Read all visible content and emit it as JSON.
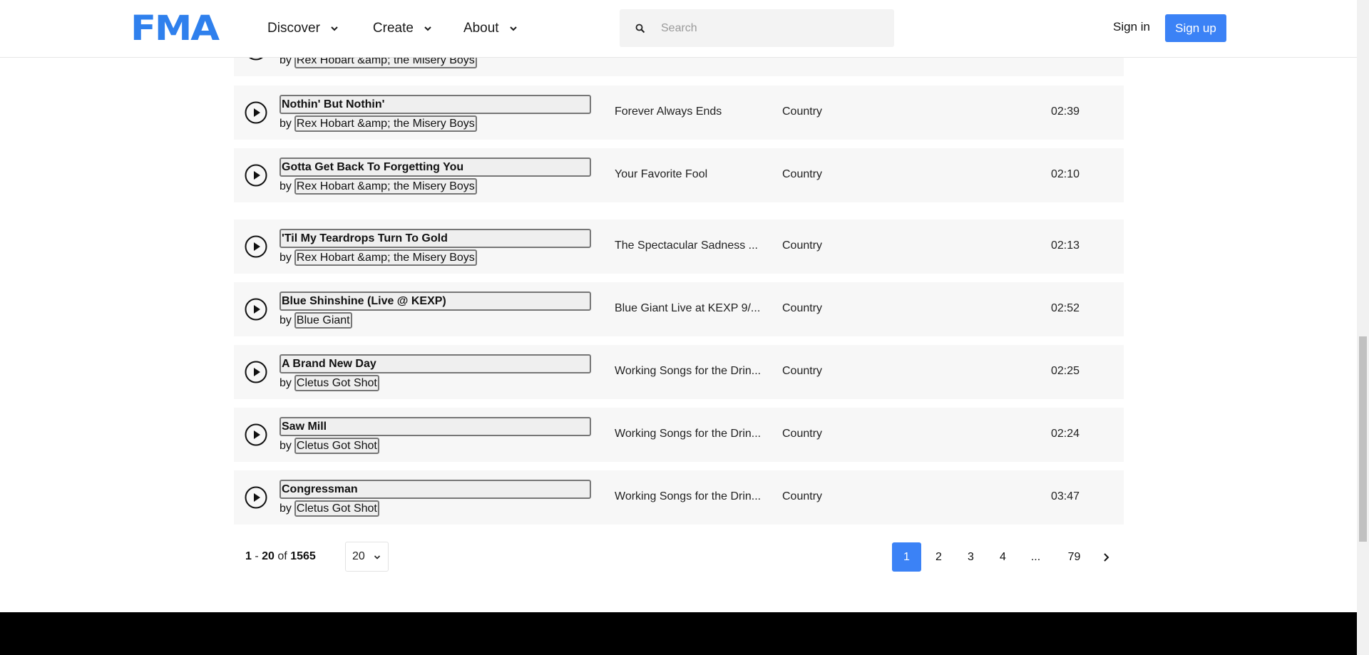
{
  "header": {
    "logo": "FMA",
    "nav": [
      {
        "label": "Discover"
      },
      {
        "label": "Create"
      },
      {
        "label": "About"
      }
    ],
    "search_placeholder": "Search",
    "sign_in": "Sign in",
    "sign_up": "Sign up"
  },
  "tracks": [
    {
      "title": "",
      "by": "by",
      "artist": "Rex Hobart &amp; the Misery Boys",
      "album": "",
      "genre": "",
      "duration": ""
    },
    {
      "title": "Nothin' But Nothin'",
      "by": "by",
      "artist": "Rex Hobart &amp; the Misery Boys",
      "album": "Forever Always Ends",
      "genre": "Country",
      "duration": "02:39"
    },
    {
      "title": "Gotta Get Back To Forgetting You",
      "by": "by",
      "artist": "Rex Hobart &amp; the Misery Boys",
      "album": "Your Favorite Fool",
      "genre": "Country",
      "duration": "02:10"
    },
    {
      "title": "'Til My Teardrops Turn To Gold",
      "by": "by",
      "artist": "Rex Hobart &amp; the Misery Boys",
      "album": "The Spectacular Sadness ...",
      "genre": "Country",
      "duration": "02:13"
    },
    {
      "title": "Blue Shinshine (Live @ KEXP)",
      "by": "by",
      "artist": "Blue Giant",
      "album": "Blue Giant Live at KEXP 9/...",
      "genre": "Country",
      "duration": "02:52"
    },
    {
      "title": "A Brand New Day",
      "by": "by",
      "artist": "Cletus Got Shot",
      "album": "Working Songs for the Drin...",
      "genre": "Country",
      "duration": "02:25"
    },
    {
      "title": "Saw Mill",
      "by": "by",
      "artist": "Cletus Got Shot",
      "album": "Working Songs for the Drin...",
      "genre": "Country",
      "duration": "02:24"
    },
    {
      "title": "Congressman",
      "by": "by",
      "artist": "Cletus Got Shot",
      "album": "Working Songs for the Drin...",
      "genre": "Country",
      "duration": "03:47"
    }
  ],
  "pagination": {
    "range_start": "1",
    "range_sep": "-",
    "range_end": "20",
    "of": "of",
    "total": "1565",
    "per_page": "20",
    "pages": [
      "1",
      "2",
      "3",
      "4",
      "...",
      "79"
    ],
    "current": "1"
  },
  "colors": {
    "accent": "#3b82f6",
    "logo": "#2f80ed",
    "row_bg": "#f7f7f7",
    "footer": "#000000"
  }
}
